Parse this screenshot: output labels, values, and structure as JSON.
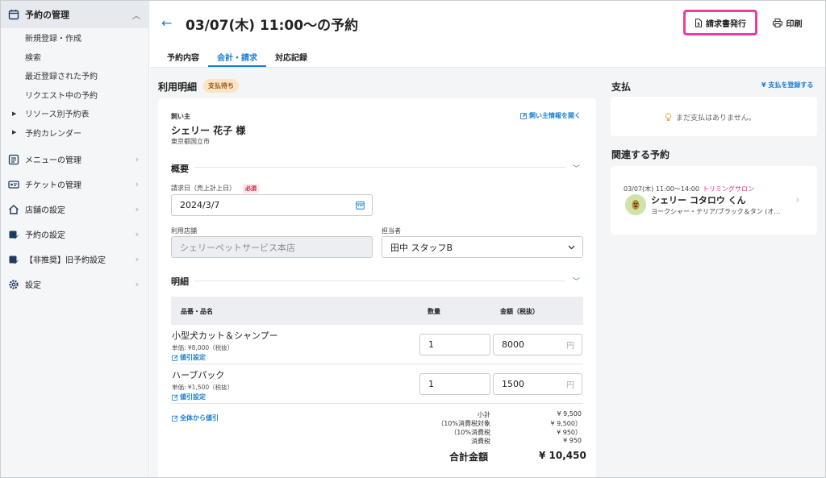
{
  "sidebar": {
    "header": "予約の管理",
    "subitems": [
      "新規登録・作成",
      "検索",
      "最近登録された予約",
      "リクエスト中の予約"
    ],
    "tree_items": [
      "リソース別予約表",
      "予約カレンダー"
    ],
    "items": [
      "メニューの管理",
      "チケットの管理",
      "店舗の設定",
      "予約の設定",
      "【非推奨】旧予約設定",
      "設定"
    ]
  },
  "header": {
    "title": "03/07(木) 11:00〜の予約",
    "invoice_button": "請求書発行",
    "print_button": "印刷"
  },
  "tabs": [
    "予約内容",
    "会計・請求",
    "対応記録"
  ],
  "billing": {
    "title": "利用明細",
    "status_badge": "支払待ち",
    "owner_label": "飼い主",
    "owner_link": "飼い主情報を開く",
    "owner_name": "シェリー 花子 様",
    "owner_address": "東京都国立市",
    "overview_title": "概要",
    "invoice_date_label": "請求日（売上計上日）",
    "required_badge": "必須",
    "invoice_date_value": "2024/3/7",
    "store_label": "利用店舗",
    "store_value": "シェリーペットサービス本店",
    "staff_label": "担当者",
    "staff_value": "田中 スタッフB",
    "details_title": "明細",
    "columns": [
      "品番・品名",
      "数量",
      "金額（税抜）"
    ],
    "yen_suffix": "円",
    "discount_link": "値引設定",
    "lines": [
      {
        "name": "小型犬カット＆シャンプー",
        "unit": "単価: ¥8,000（税抜）",
        "qty": "1",
        "amount": "8000"
      },
      {
        "name": "ハーブパック",
        "unit": "単価: ¥1,500（税抜）",
        "qty": "1",
        "amount": "1500"
      }
    ],
    "overall_discount_link": "全体から値引",
    "summary": [
      {
        "label": "小計",
        "value": "¥ 9,500"
      },
      {
        "label": "（10%消費税対象",
        "value": "¥ 9,500）"
      },
      {
        "label": "（10%消費税",
        "value": "¥ 950）"
      },
      {
        "label": "消費税",
        "value": "¥ 950"
      }
    ],
    "total_label": "合計金額",
    "total_value": "¥ 10,450"
  },
  "payment": {
    "title": "支払",
    "register_link": "¥ 支払を登録する",
    "empty_message": "まだ支払はありません。"
  },
  "related": {
    "title": "関連する予約",
    "meta": "03/07(木) 11:00〜14:00",
    "salon": "トリミングサロン",
    "name": "シェリー コタロウ くん",
    "breed": "ヨークシャー・テリア/ブラック＆タン (オ…"
  },
  "colors": {
    "accent": "#1a7fd4",
    "highlight": "#ec3c9e",
    "salon": "#e0307f"
  }
}
